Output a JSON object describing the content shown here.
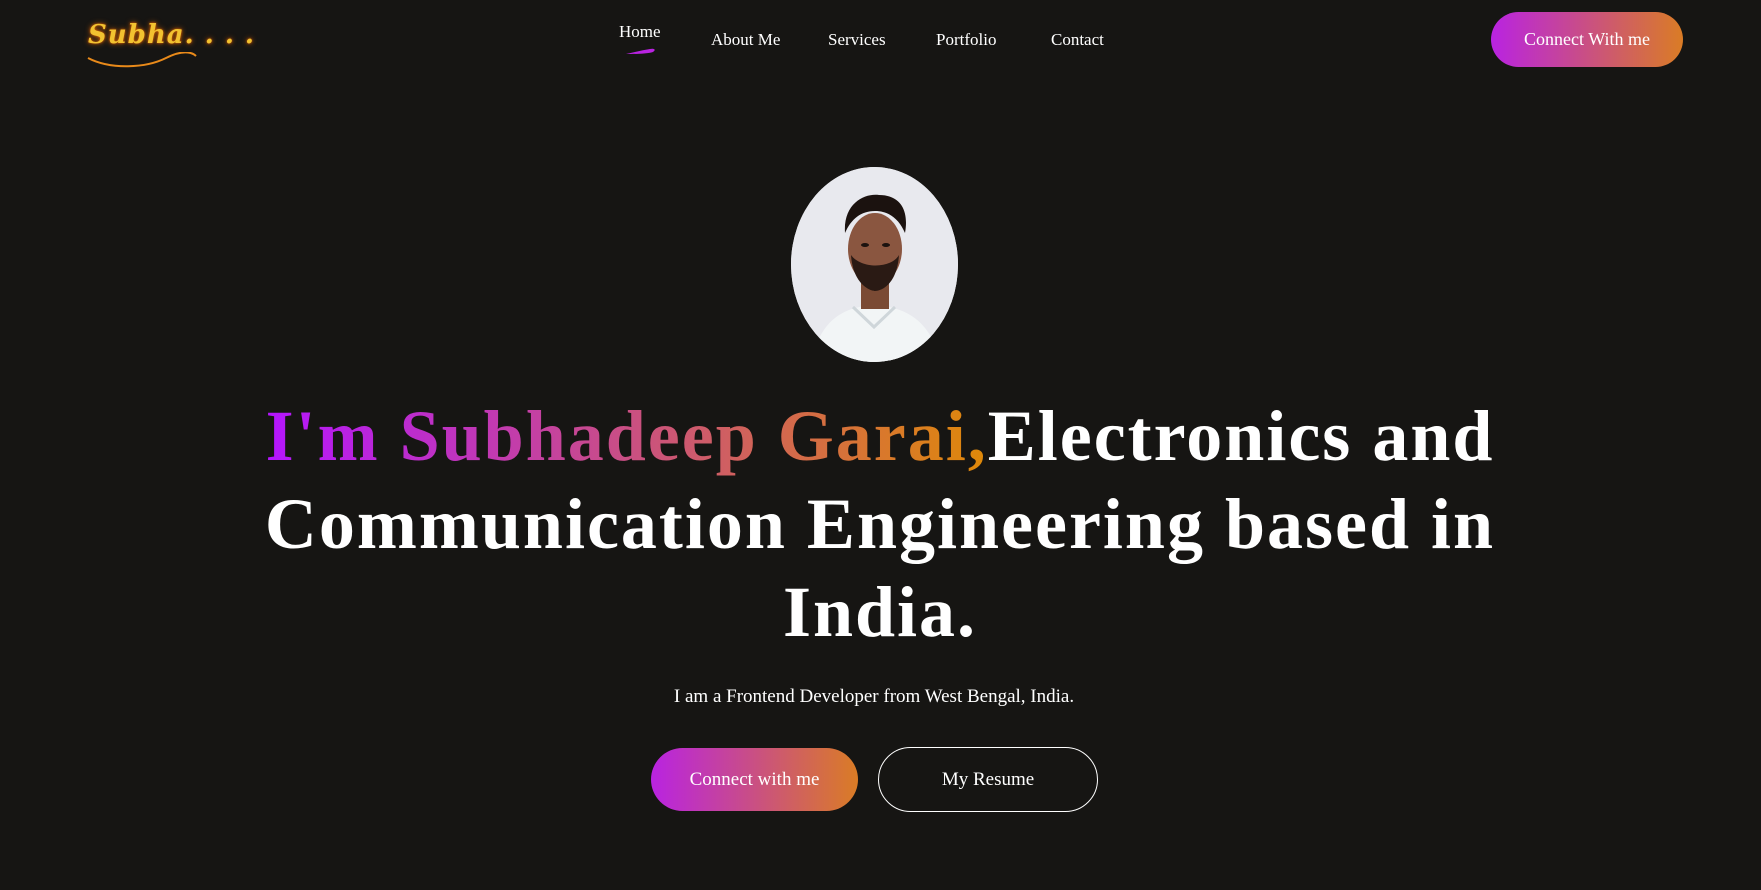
{
  "navbar": {
    "logo_text": "Subha. . . .",
    "menu": [
      {
        "label": "Home",
        "active": true
      },
      {
        "label": "About Me"
      },
      {
        "label": "Services"
      },
      {
        "label": "Portfolio"
      },
      {
        "label": "Contact"
      }
    ],
    "connect_button": "Connect With me"
  },
  "hero": {
    "avatar_icon": "profile-photo",
    "title_name": "I'm Subhadeep Garai,",
    "title_rest": "Electronics and Communication Engineering based in India.",
    "subtitle": "I am a Frontend Developer from West Bengal, India.",
    "primary_button": "Connect with me",
    "secondary_button": "My Resume"
  },
  "colors": {
    "background": "#161513",
    "gradient_start": "#b415ff",
    "gradient_end": "#df8908",
    "logo": "#f2c230"
  }
}
